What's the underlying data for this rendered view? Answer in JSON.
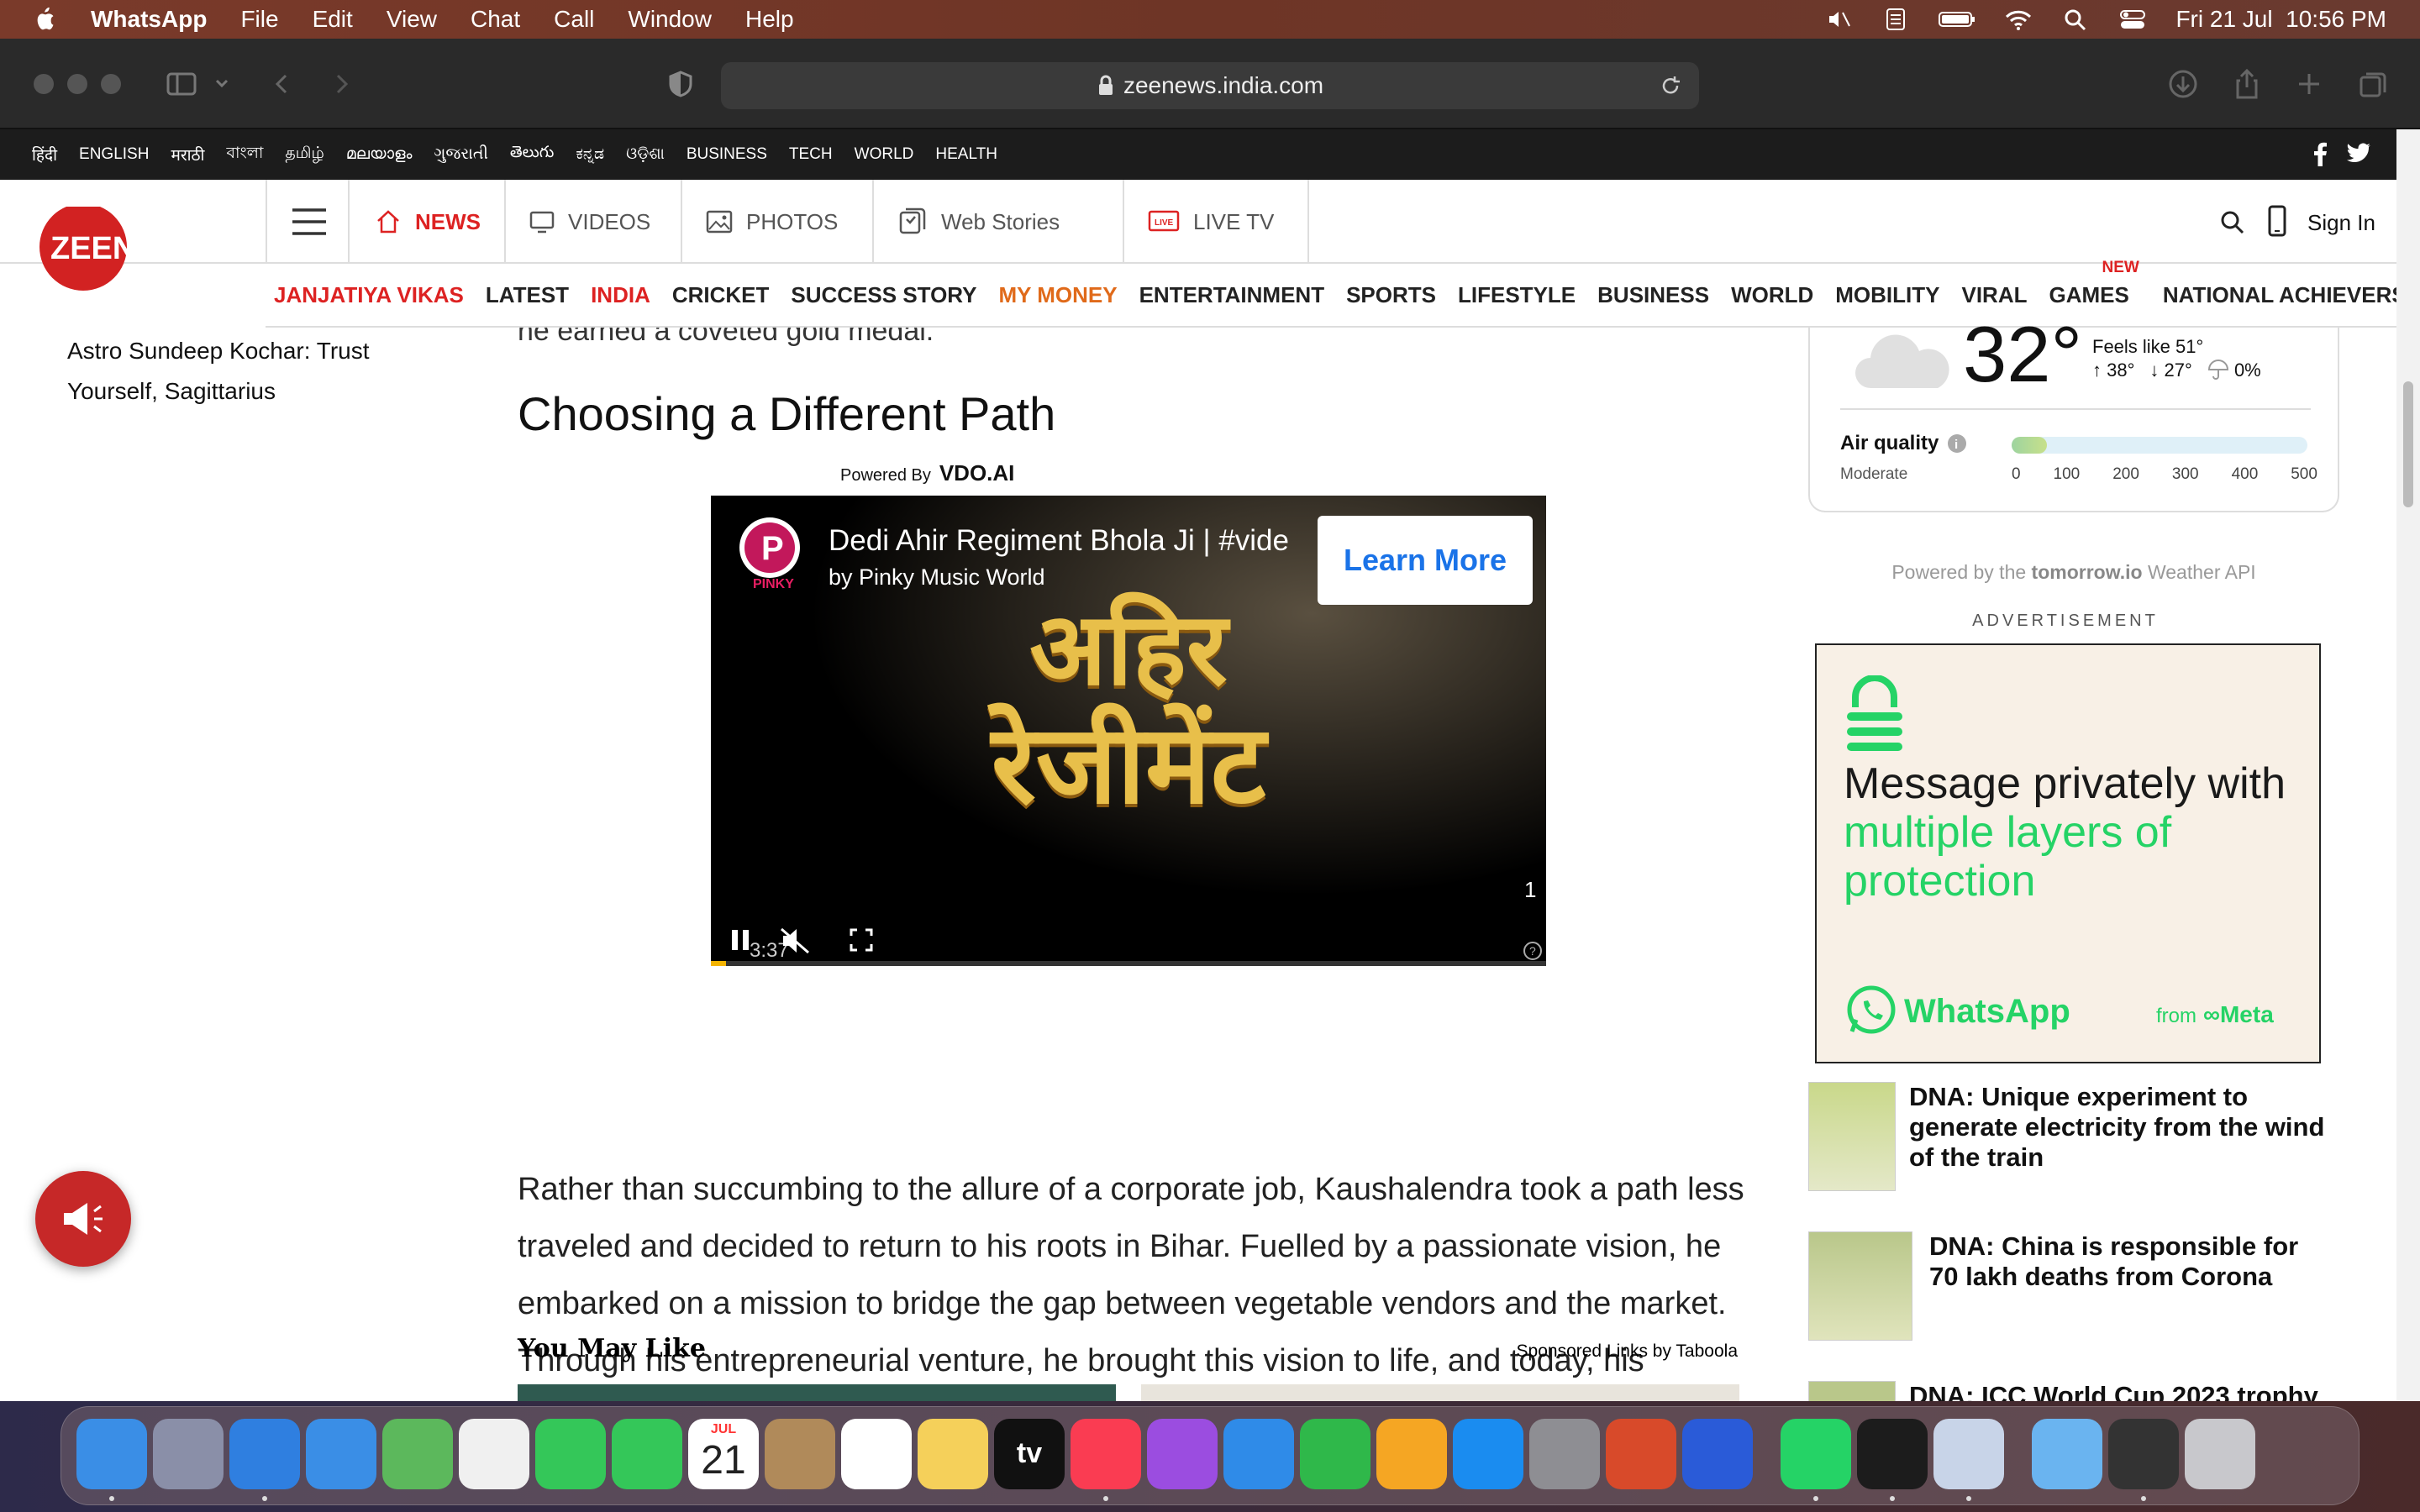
{
  "menubar": {
    "app": "WhatsApp",
    "items": [
      "File",
      "Edit",
      "View",
      "Chat",
      "Call",
      "Window",
      "Help"
    ],
    "datetime": "Fri 21 Jul  10:56 PM"
  },
  "browser": {
    "url": "zeenews.india.com"
  },
  "langbar": {
    "items": [
      "हिंदी",
      "ENGLISH",
      "मराठी",
      "বাংলা",
      "தமிழ்",
      "മലയാളം",
      "ગુજરાતી",
      "తెలుగు",
      "ಕನ್ನಡ",
      "ଓଡ଼ିଶା",
      "BUSINESS",
      "TECH",
      "WORLD",
      "HEALTH"
    ]
  },
  "brand": {
    "logo_text": "ZEENEWS",
    "red": "#d22222"
  },
  "mainnav": {
    "tabs": [
      {
        "label": "NEWS",
        "icon": "home-icon"
      },
      {
        "label": "VIDEOS",
        "icon": "monitor-icon"
      },
      {
        "label": "PHOTOS",
        "icon": "image-icon"
      },
      {
        "label": "Web Stories",
        "icon": "stories-icon"
      },
      {
        "label": "LIVE TV",
        "icon": "live-tv-icon"
      }
    ],
    "signin": "Sign In"
  },
  "categories": [
    "JANJATIYA VIKAS",
    "LATEST",
    "INDIA",
    "CRICKET",
    "SUCCESS STORY",
    "MY MONEY",
    "ENTERTAINMENT",
    "SPORTS",
    "LIFESTYLE",
    "BUSINESS",
    "WORLD",
    "MOBILITY",
    "VIRAL",
    "GAMES",
    "NATIONAL ACHIEVERS AWARD"
  ],
  "new_tag": "NEW",
  "leftcol": {
    "story": "Astro Sundeep Kochar: Trust Yourself, Sagittarius"
  },
  "article": {
    "fade_text": "he earned a coveted gold medal.",
    "heading": "Choosing a Different Path",
    "powered_by": "Powered By",
    "vdo": "VDO.AI",
    "video": {
      "title": "Dedi Ahir Regiment Bhola Ji | #vide",
      "channel": "by Pinky Music World",
      "cta": "Learn More",
      "overlay_line1": "अहिर",
      "overlay_line2": "रेजीमेंट",
      "time": "3:37",
      "counter": "1",
      "logo": "PINKY"
    },
    "paragraph": "Rather than succumbing to the allure of a corporate job, Kaushalendra took a path less traveled and decided to return to his roots in Bihar. Fuelled by a passionate vision, he embarked on a mission to bridge the gap between vegetable vendors and the market. Through his entrepreneurial venture, he brought this vision to life, and today, his company boasts an impressive multi-million-dollar turnover.",
    "you_may_like": "You May Like",
    "sponsored": "Sponsored Links by Taboola"
  },
  "weather": {
    "temp": "32°",
    "feels": "Feels like 51°",
    "high": "38°",
    "low": "27°",
    "rain": "0%",
    "aq_label": "Air quality",
    "aq_status": "Moderate",
    "aq_ticks": [
      "0",
      "100",
      "200",
      "300",
      "400",
      "500"
    ],
    "aq_level": 0.12,
    "powered_prefix": "Powered by the",
    "powered_brand": "tomorrow.io",
    "powered_suffix": "Weather API"
  },
  "ad": {
    "label": "ADVERTISEMENT",
    "headline_a": "Message privately with ",
    "headline_b": "multiple layers of protection",
    "brand": "WhatsApp",
    "from": "from",
    "meta": "Meta"
  },
  "news": [
    {
      "title": "DNA: Unique experiment to generate electricity from the wind of the train"
    },
    {
      "title": "DNA: China is responsible for 70 lakh deaths from Corona"
    },
    {
      "title": "DNA: ICC World Cup 2023 trophy"
    }
  ],
  "dock": {
    "calendar_month": "JUL",
    "calendar_day": "21",
    "apps": [
      "finder-icon",
      "launchpad-icon",
      "safari-icon",
      "mail-icon",
      "maps-icon",
      "photos-icon",
      "messages-icon",
      "facetime-icon",
      "calendar-icon",
      "contacts-icon",
      "reminders-icon",
      "notes-icon",
      "appletv-icon",
      "music-icon",
      "podcasts-icon",
      "keynote-icon",
      "numbers-icon",
      "pages-icon",
      "appstore-icon",
      "settings-icon",
      "remote-desktop-icon",
      "vpn-icon",
      "whatsapp-icon",
      "terminal-icon",
      "preview-icon",
      "folder-icon",
      "screenshot-icon",
      "trash-icon"
    ],
    "appletv_label": "tv"
  }
}
